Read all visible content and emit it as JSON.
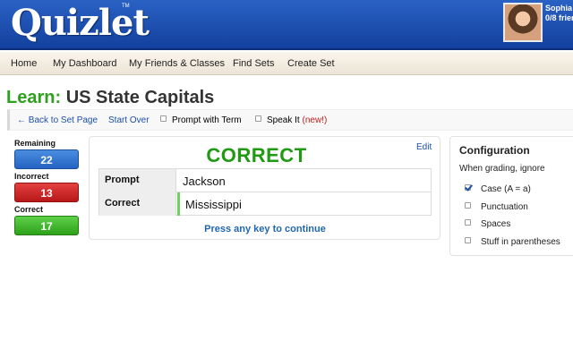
{
  "header": {
    "logo": "Quizlet",
    "trademark": "TM",
    "user_name": "Sophia",
    "user_friends": "0/8 frien"
  },
  "nav": {
    "items": [
      "Home",
      "My Dashboard",
      "My Friends & Classes",
      "Find Sets",
      "Create Set"
    ]
  },
  "page": {
    "mode": "Learn:",
    "set_name": "US State Capitals"
  },
  "toolbar": {
    "back": "← Back to Set Page",
    "start_over": "Start Over",
    "prompt_with_term": "Prompt with Term",
    "speak_it": "Speak It",
    "new_tag": "(new!)"
  },
  "stats": {
    "remaining_label": "Remaining",
    "remaining": "22",
    "incorrect_label": "Incorrect",
    "incorrect": "13",
    "correct_label": "Correct",
    "correct": "17"
  },
  "card": {
    "result": "CORRECT",
    "edit": "Edit",
    "prompt_label": "Prompt",
    "prompt_value": "Jackson",
    "correct_label": "Correct",
    "correct_value": "Mississippi",
    "continue": "Press any key to continue"
  },
  "config": {
    "title": "Configuration",
    "subtitle": "When grading, ignore",
    "options": [
      {
        "label": "Case (A = a)",
        "checked": true
      },
      {
        "label": "Punctuation",
        "checked": false
      },
      {
        "label": "Spaces",
        "checked": false
      },
      {
        "label": "Stuff in parentheses",
        "checked": false
      }
    ]
  },
  "colors": {
    "brand_blue": "#1d4fb0",
    "learn_green": "#2f9f1e",
    "correct_green": "#1f9a12",
    "incorrect_red": "#c41e1e",
    "remaining_blue": "#2f74d0"
  }
}
